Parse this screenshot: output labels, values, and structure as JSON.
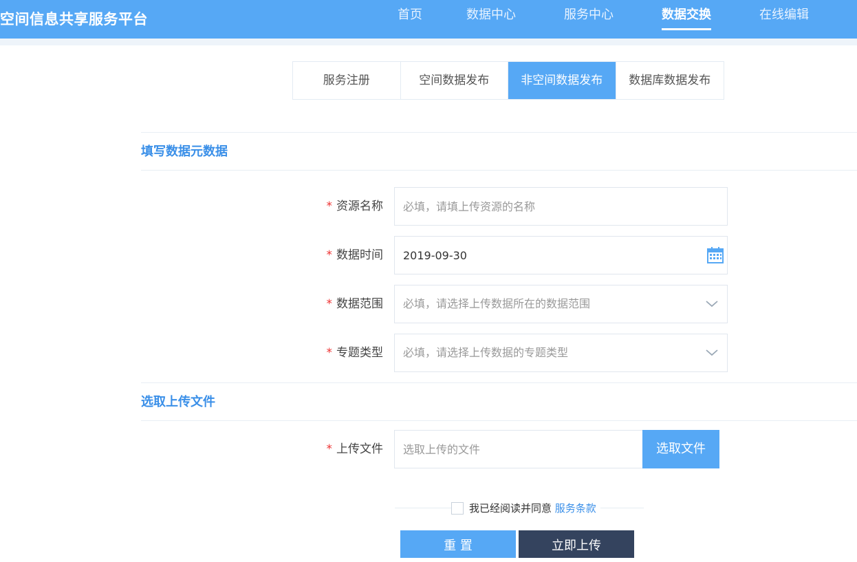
{
  "header": {
    "brand": "空间信息共享服务平台",
    "nav": [
      {
        "label": "首页",
        "active": false
      },
      {
        "label": "数据中心",
        "active": false
      },
      {
        "label": "服务中心",
        "active": false
      },
      {
        "label": "数据交换",
        "active": true
      },
      {
        "label": "在线编辑",
        "active": false
      }
    ],
    "accent": "#56a8f5"
  },
  "tabs": [
    {
      "label": "服务注册",
      "active": false
    },
    {
      "label": "空间数据发布",
      "active": false
    },
    {
      "label": "非空间数据发布",
      "active": true
    },
    {
      "label": "数据库数据发布",
      "active": false
    }
  ],
  "metadata_section": {
    "title": "填写数据元数据",
    "fields": {
      "resource_name": {
        "label": "资源名称",
        "required_mark": "*",
        "placeholder": "必填，请填上传资源的名称",
        "value": ""
      },
      "data_time": {
        "label": "数据时间",
        "required_mark": "*",
        "value": "2019-09-30",
        "icon": "calendar-icon"
      },
      "data_range": {
        "label": "数据范围",
        "required_mark": "*",
        "placeholder": "必填，请选择上传数据所在的数据范围",
        "icon": "chevron-down-icon"
      },
      "topic_type": {
        "label": "专题类型",
        "required_mark": "*",
        "placeholder": "必填，请选择上传数据的专题类型",
        "icon": "chevron-down-icon"
      }
    }
  },
  "upload_section": {
    "title": "选取上传文件",
    "field": {
      "label": "上传文件",
      "required_mark": "*",
      "placeholder": "选取上传的文件",
      "button": "选取文件"
    }
  },
  "agreement": {
    "text": "我已经阅读并同意",
    "link": "服务条款"
  },
  "actions": {
    "reset": "重 置",
    "submit": "立即上传"
  }
}
